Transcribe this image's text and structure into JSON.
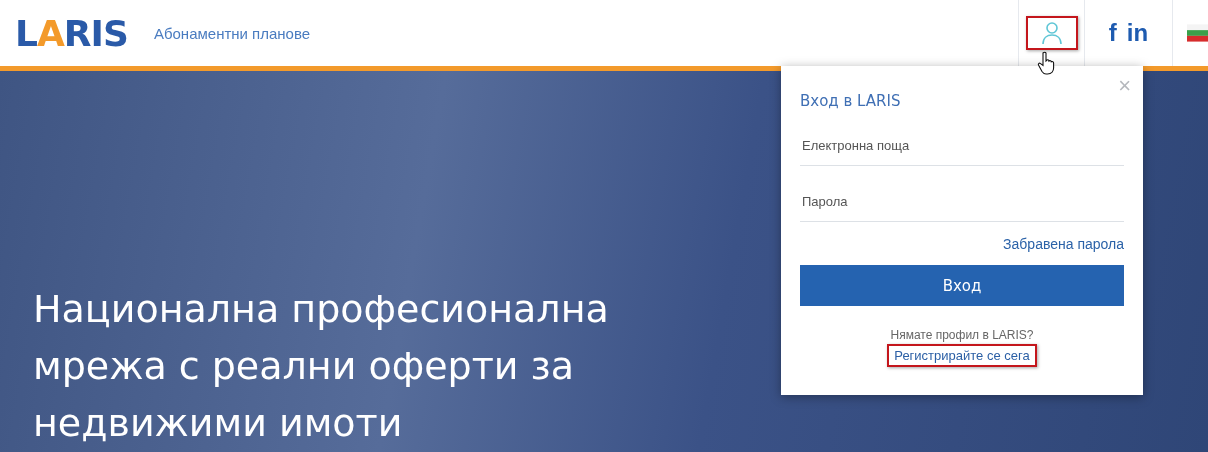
{
  "header": {
    "logo": "LARIS",
    "nav_link": "Абонаментни планове",
    "profile_button": {
      "highlighted": true
    },
    "social": [
      "f",
      "in"
    ]
  },
  "hero": {
    "headline_lines": [
      "Национална професионална",
      "мрежа с реални оферти за",
      "недвижими имоти"
    ]
  },
  "login_popup": {
    "close": "×",
    "title": "Вход в LARIS",
    "email": {
      "placeholder": "Електронна поща"
    },
    "password": {
      "placeholder": "Парола"
    },
    "forgot_link": "Забравена парола",
    "submit": "Вход",
    "no_account": "Нямате профил в LARIS?",
    "register_link": {
      "text": "Регистрирайте се сега",
      "highlighted": true
    }
  }
}
